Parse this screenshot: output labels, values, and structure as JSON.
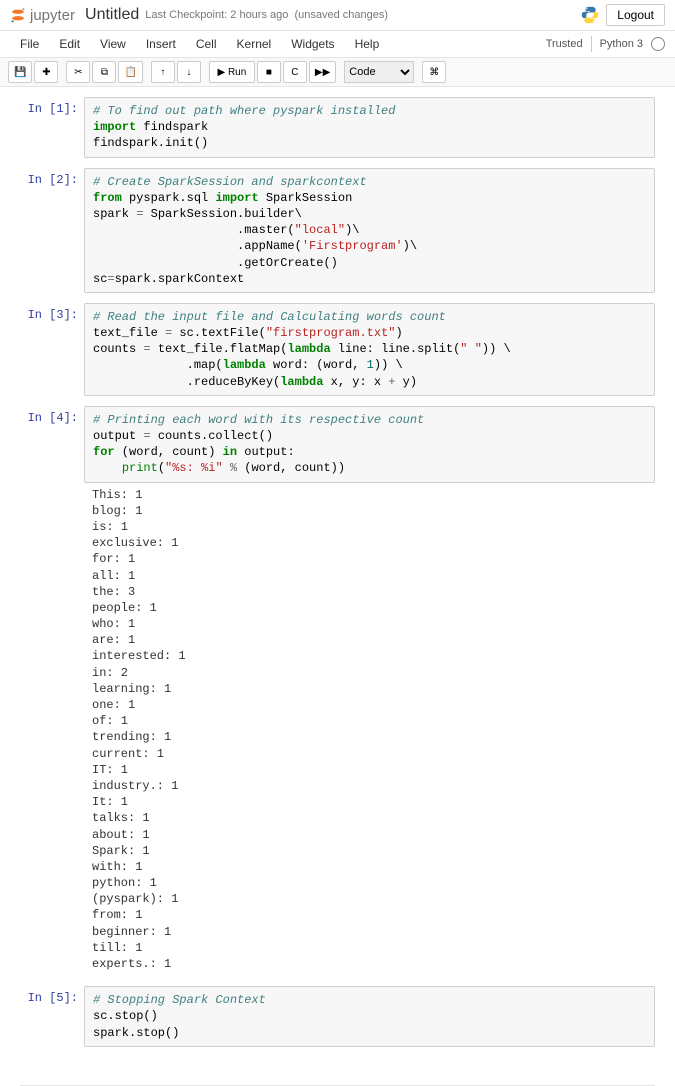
{
  "header": {
    "logo_text": "jupyter",
    "title": "Untitled",
    "checkpoint": "Last Checkpoint: 2 hours ago",
    "autosave": "(unsaved changes)",
    "logout": "Logout"
  },
  "menus": [
    "File",
    "Edit",
    "View",
    "Insert",
    "Cell",
    "Kernel",
    "Widgets",
    "Help"
  ],
  "menu_right": {
    "trusted": "Trusted",
    "kernel": "Python 3"
  },
  "toolbar": {
    "save": "💾",
    "add": "✚",
    "cut": "✂",
    "copy": "⧉",
    "paste": "📋",
    "up": "↑",
    "down": "↓",
    "run": "▶ Run",
    "stop": "■",
    "restart": "C",
    "ff": "▶▶",
    "celltype": "Code",
    "cmd": "⌘"
  },
  "cells": [
    {
      "prompt": "In [1]:",
      "code_html": "<span class='c-комм'># To find out path where pyspark installed</span>\n<span class='c-kw'>import</span> findspark\nfindspark.init()"
    },
    {
      "prompt": "In [2]:",
      "code_html": "<span class='c-комм'># Create SparkSession and sparkcontext</span>\n<span class='c-kw'>from</span> pyspark.sql <span class='c-kw'>import</span> SparkSession\nspark <span class='c-op'>=</span> SparkSession.builder\\\n                    .master(<span class='c-str'>\"local\"</span>)\\\n                    .appName(<span class='c-str'>'Firstprogram'</span>)\\\n                    .getOrCreate()\nsc<span class='c-op'>=</span>spark.sparkContext"
    },
    {
      "prompt": "In [3]:",
      "code_html": "<span class='c-комм'># Read the input file and Calculating words count</span>\ntext_file <span class='c-op'>=</span> sc.textFile(<span class='c-str'>\"firstprogram.txt\"</span>)\ncounts <span class='c-op'>=</span> text_file.flatMap(<span class='c-kw'>lambda</span> line: line.split(<span class='c-str'>\" \"</span>)) \\\n             .map(<span class='c-kw'>lambda</span> word: (word, <span class='c-num'>1</span>)) \\\n             .reduceByKey(<span class='c-kw'>lambda</span> x, y: x <span class='c-op'>+</span> y)"
    },
    {
      "prompt": "In [4]:",
      "code_html": "<span class='c-комм'># Printing each word with its respective count</span>\noutput <span class='c-op'>=</span> counts.collect()\n<span class='c-kw'>for</span> (word, count) <span class='c-kw'>in</span> output:\n    <span class='c-builtin'>print</span>(<span class='c-str'>\"%s: %i\"</span> <span class='c-op'>%</span> (word, count))",
      "output": "This: 1\nblog: 1\nis: 1\nexclusive: 1\nfor: 1\nall: 1\nthe: 3\npeople: 1\nwho: 1\nare: 1\ninterested: 1\nin: 2\nlearning: 1\none: 1\nof: 1\ntrending: 1\ncurrent: 1\nIT: 1\nindustry.: 1\nIt: 1\ntalks: 1\nabout: 1\nSpark: 1\nwith: 1\npython: 1\n(pyspark): 1\nfrom: 1\nbeginner: 1\ntill: 1\nexperts.: 1"
    },
    {
      "prompt": "In [5]:",
      "code_html": "<span class='c-комм'># Stopping Spark Context</span>\nsc.stop()\nspark.stop()"
    }
  ]
}
